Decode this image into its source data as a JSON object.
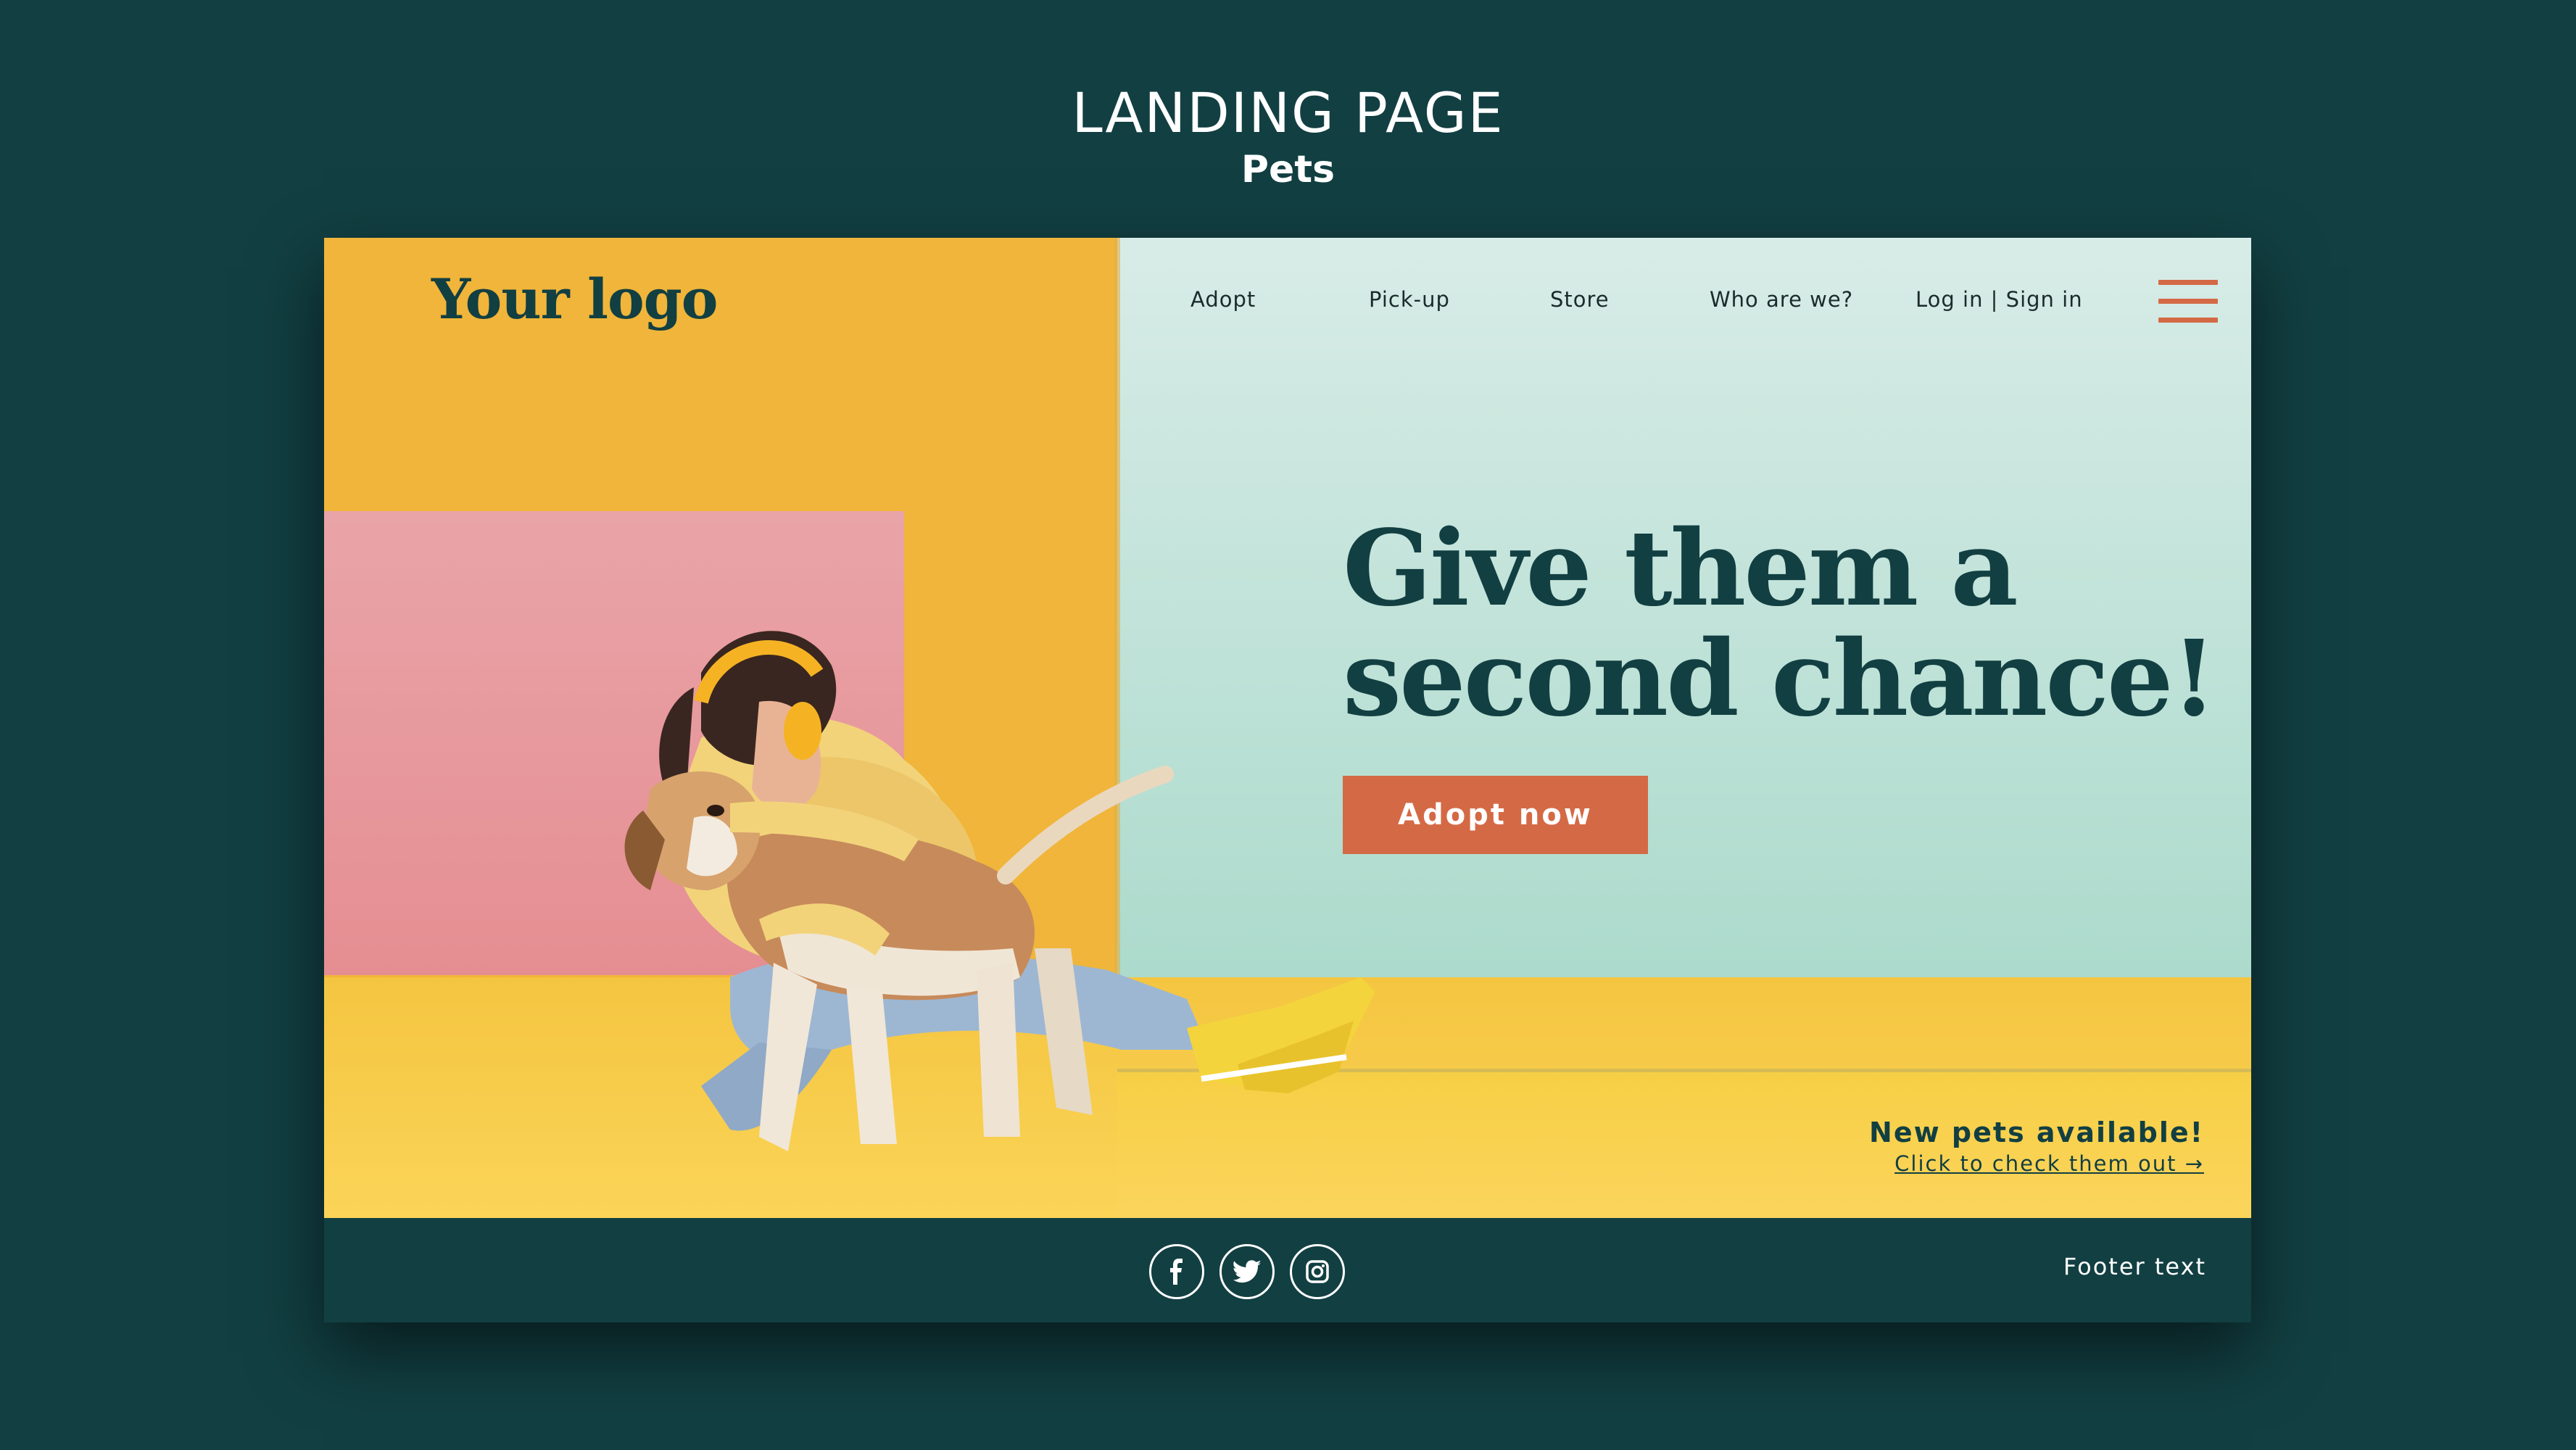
{
  "page": {
    "title": "LANDING PAGE",
    "subtitle": "Pets"
  },
  "site": {
    "logo": "Your logo",
    "nav": [
      "Adopt",
      "Pick-up",
      "Store",
      "Who are we?",
      "Log in | Sign in"
    ],
    "menu_icon": "hamburger-menu-icon",
    "hero": {
      "headline_line1": "Give them a",
      "headline_line2": "second chance!",
      "cta": "Adopt now"
    },
    "promo": {
      "title": "New pets available!",
      "link": "Click to check them out →"
    },
    "footer": {
      "socials": [
        "facebook-icon",
        "twitter-icon",
        "instagram-icon"
      ],
      "text": "Footer text"
    }
  },
  "colors": {
    "background": "#123f42",
    "accent": "#d46a45",
    "yellow": "#f0b53a",
    "mint": "#a6d8c8",
    "pink": "#e9a4a8"
  }
}
